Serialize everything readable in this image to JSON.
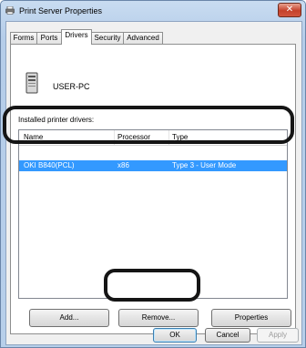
{
  "window": {
    "title": "Print Server Properties",
    "close_label": "✕"
  },
  "tabs": [
    {
      "label": "Forms"
    },
    {
      "label": "Ports"
    },
    {
      "label": "Drivers",
      "active": true
    },
    {
      "label": "Security"
    },
    {
      "label": "Advanced"
    }
  ],
  "server": {
    "name": "USER-PC",
    "icon": "computer-tower-icon"
  },
  "drivers": {
    "label": "Installed printer drivers:",
    "columns": [
      "Name",
      "Processor",
      "Type"
    ],
    "rows": [
      {
        "name": "OKI B840(PCL)",
        "processor": "x86",
        "type": "Type 3 - User Mode",
        "selected": true
      }
    ]
  },
  "buttons": {
    "add": "Add...",
    "remove": "Remove...",
    "properties": "Properties",
    "ok": "OK",
    "cancel": "Cancel",
    "apply": "Apply"
  },
  "colors": {
    "selection": "#3399ff",
    "highlight_ring": "#151515"
  }
}
